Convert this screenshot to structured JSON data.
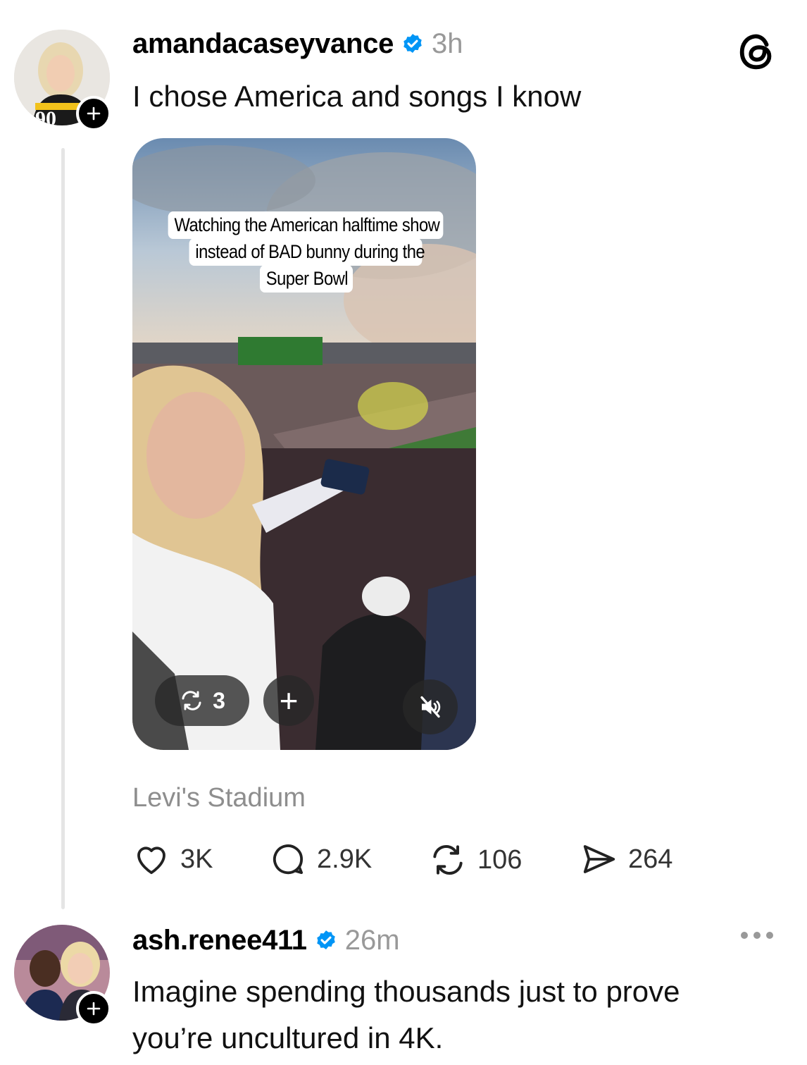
{
  "post": {
    "username": "amandacaseyvance",
    "timestamp": "3h",
    "text": "I chose America and songs I know",
    "media": {
      "caption_lines": [
        "Watching the American halftime show",
        "instead of BAD bunny during the",
        "Super Bowl"
      ],
      "repost_count": "3",
      "add_symbol": "+"
    },
    "location": "Levi's Stadium",
    "actions": {
      "likes": "3K",
      "comments": "2.9K",
      "reposts": "106",
      "shares": "264"
    }
  },
  "reply": {
    "username": "ash.renee411",
    "timestamp": "26m",
    "text_line1": "Imagine spending thousands just to prove",
    "text_line2": "you’re uncultured in 4K."
  },
  "icons": {
    "brand": "threads-logo-icon",
    "verified": "verified-badge-icon",
    "like": "heart-icon",
    "comment": "comment-bubble-icon",
    "repost": "repost-icon",
    "share": "send-icon",
    "mute": "speaker-muted-icon",
    "more": "more-dots-icon",
    "follow": "plus-icon"
  },
  "colors": {
    "verified_blue": "#0095f6",
    "muted_text": "#999999",
    "thread_line": "#e5e5e5"
  }
}
